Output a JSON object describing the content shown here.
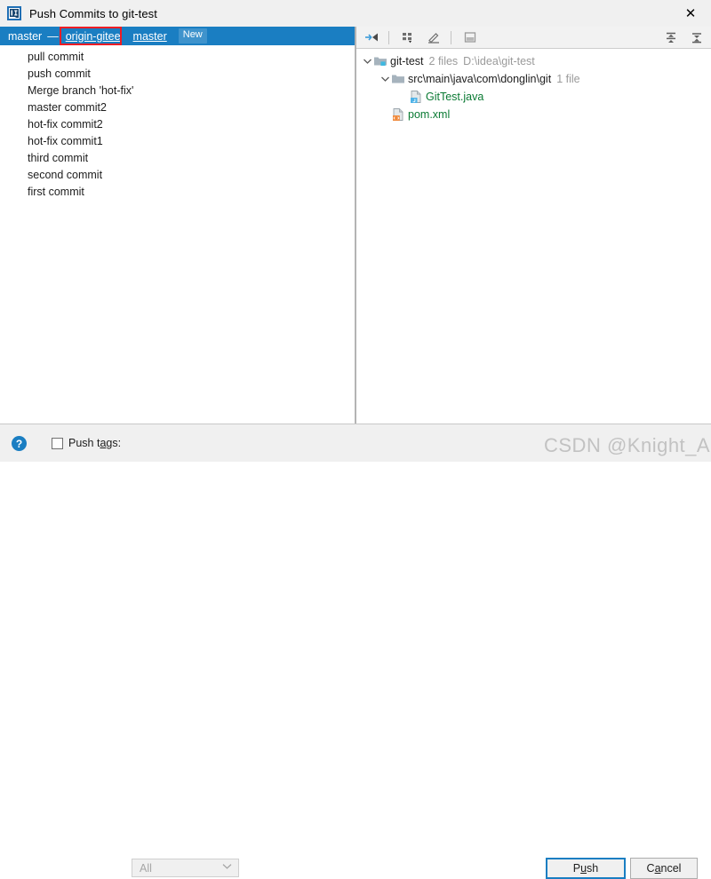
{
  "window": {
    "title": "Push Commits to git-test",
    "app_icon": "intellij-idea-icon",
    "close_label": "✕"
  },
  "branch_bar": {
    "local_branch": "master",
    "separator": "—",
    "remote": "origin-gitee",
    "remote_branch": "master",
    "badge": "New",
    "highlight_color": "#ed1c24",
    "background_color": "#1a7ec2"
  },
  "commits": [
    {
      "message": "pull commit"
    },
    {
      "message": "push commit"
    },
    {
      "message": "Merge branch 'hot-fix'"
    },
    {
      "message": "master commit2"
    },
    {
      "message": "hot-fix commit2"
    },
    {
      "message": "hot-fix commit1"
    },
    {
      "message": "third commit"
    },
    {
      "message": "second commit"
    },
    {
      "message": "first commit"
    }
  ],
  "file_toolbar": {
    "buttons": [
      {
        "name": "expand-collapse-icon",
        "tooltip": "Collapse"
      },
      {
        "name": "group-by-icon",
        "tooltip": "Group By"
      },
      {
        "name": "edit-source-icon",
        "tooltip": "Edit Source"
      },
      {
        "name": "preview-diff-icon",
        "tooltip": "Preview Diff"
      }
    ],
    "right_buttons": [
      {
        "name": "expand-all-icon",
        "tooltip": "Expand All"
      },
      {
        "name": "collapse-all-icon",
        "tooltip": "Collapse All"
      }
    ]
  },
  "file_tree": [
    {
      "icon": "module-folder-icon",
      "label": "git-test",
      "meta_count": "2 files",
      "meta_path": "D:\\idea\\git-test",
      "depth": 0,
      "expanded": true,
      "has_arrow": true,
      "color": "default"
    },
    {
      "icon": "folder-icon",
      "label": "src\\main\\java\\com\\donglin\\git",
      "meta_count": "1 file",
      "meta_path": "",
      "depth": 1,
      "expanded": true,
      "has_arrow": true,
      "color": "default"
    },
    {
      "icon": "java-file-icon",
      "label": "GitTest.java",
      "meta_count": "",
      "meta_path": "",
      "depth": 2,
      "expanded": false,
      "has_arrow": false,
      "color": "green"
    },
    {
      "icon": "xml-file-icon",
      "label": "pom.xml",
      "meta_count": "",
      "meta_path": "",
      "depth": 1,
      "expanded": false,
      "has_arrow": false,
      "color": "green"
    }
  ],
  "bottom_bar": {
    "help_label": "?",
    "push_tags_checked": false,
    "push_tags_label_pre": "Push t",
    "push_tags_label_mnemonic": "a",
    "push_tags_label_post": "gs:",
    "tags_combo_value": "All",
    "tags_combo_arrow": "⌄",
    "push_button_pre": "P",
    "push_button_mnemonic": "u",
    "push_button_post": "sh",
    "cancel_button_pre": "C",
    "cancel_button_mnemonic": "a",
    "cancel_button_post": "ncel"
  },
  "watermark": {
    "text": "CSDN @Knight_AL"
  }
}
